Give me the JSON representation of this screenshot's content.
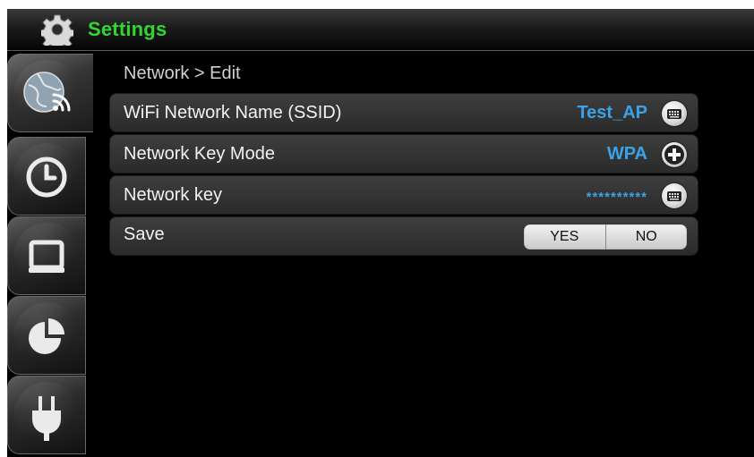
{
  "header": {
    "title": "Settings",
    "icon": "gear-icon"
  },
  "sidebar": {
    "tabs": [
      {
        "name": "network",
        "icon": "globe-wifi-icon",
        "active": true
      },
      {
        "name": "clock",
        "icon": "clock-icon",
        "active": false
      },
      {
        "name": "display",
        "icon": "monitor-icon",
        "active": false
      },
      {
        "name": "statistics",
        "icon": "pie-chart-icon",
        "active": false
      },
      {
        "name": "power",
        "icon": "power-plug-icon",
        "active": false
      }
    ]
  },
  "breadcrumb": "Network > Edit",
  "rows": {
    "ssid": {
      "label": "WiFi Network Name (SSID)",
      "value": "Test_AP",
      "icon": "keyboard-icon"
    },
    "key_mode": {
      "label": "Network Key Mode",
      "value": "WPA",
      "icon": "plus-icon"
    },
    "key": {
      "label": "Network key",
      "value": "**********",
      "icon": "keyboard-icon"
    },
    "save": {
      "label": "Save",
      "yes": "YES",
      "no": "NO"
    }
  },
  "colors": {
    "title": "#33d533",
    "value": "#3aa3e8",
    "background": "#000000"
  }
}
